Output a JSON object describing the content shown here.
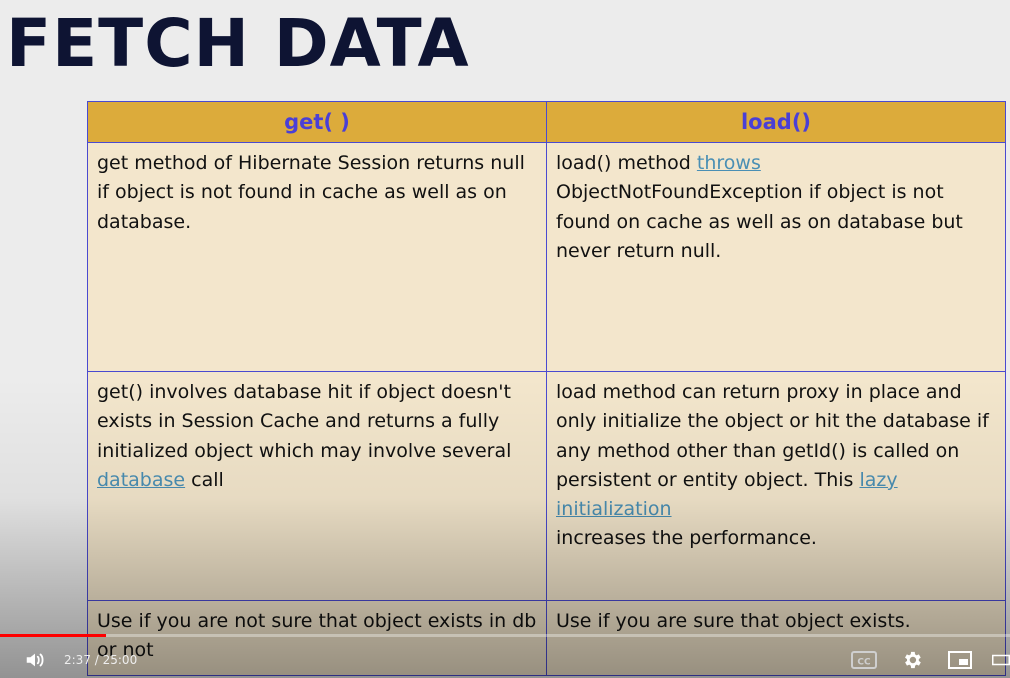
{
  "slide": {
    "title": "FETCH DATA"
  },
  "table": {
    "headers": [
      "get(  )",
      "load()"
    ],
    "rows": [
      {
        "get_parts": [
          "get method of Hibernate Session returns null if object is not found in cache as well as on database."
        ],
        "load_text_before": "load() method ",
        "load_link": "throws",
        "load_text_after": " ObjectNotFoundException if object is not found on cache as well as on database but never return null."
      },
      {
        "get_text_before": "get() involves database hit if object doesn't exists in Session Cache and returns a fully initialized object which may involve several ",
        "get_link": "database",
        "get_text_after": " call",
        "load_text_before": "load method can return proxy in place and only initialize the object or hit the database if any method other than getId() is called on persistent or entity object. This ",
        "load_link": "lazy initialization",
        "load_text_after": " increases the performance."
      },
      {
        "get_text": "Use if you are not sure that object exists in db or not",
        "load_text": "Use if you are sure that object exists."
      }
    ]
  },
  "player": {
    "current_time": "2:37",
    "duration": "25:00",
    "time_display": "2:37 / 25:00",
    "progress_fraction": 0.105,
    "buffered_fraction": 0.105,
    "accent_color": "#ff0000",
    "icons": [
      "volume-icon",
      "cc-icon",
      "settings-gear-icon",
      "miniplayer-icon",
      "theater-mode-icon"
    ]
  }
}
